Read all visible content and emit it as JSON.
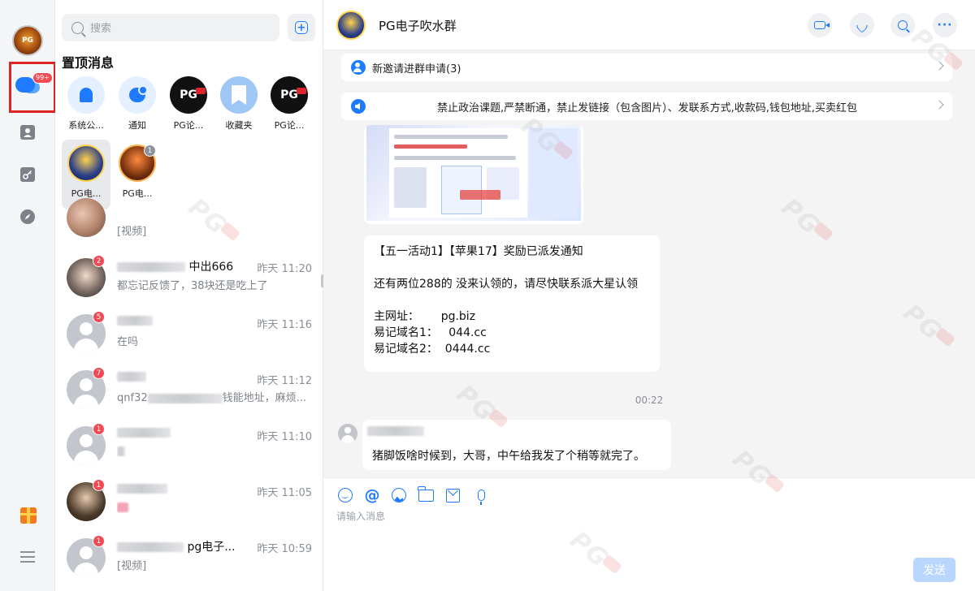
{
  "rail": {
    "avatar_text": "PG",
    "unread_badge": "99+",
    "accent": "#1E7BFF",
    "items": [
      {
        "name": "messages",
        "icon": "chat-bubbles-icon"
      },
      {
        "name": "contacts",
        "icon": "contact-card-icon"
      },
      {
        "name": "tools",
        "icon": "key-icon"
      },
      {
        "name": "discover",
        "icon": "compass-icon"
      }
    ],
    "bottom": [
      {
        "icon": "gift-icon"
      },
      {
        "icon": "menu-icon"
      }
    ]
  },
  "list": {
    "search_placeholder": "搜索",
    "pinned_title": "置顶消息",
    "pinned": [
      {
        "label": "系统公...",
        "kind": "bell"
      },
      {
        "label": "通知",
        "kind": "notice"
      },
      {
        "label": "PG论...",
        "kind": "pg",
        "logo_text": "PG"
      },
      {
        "label": "收藏夹",
        "kind": "fav"
      },
      {
        "label": "PG论...",
        "kind": "pg",
        "logo_text": "PG"
      },
      {
        "label": "PG电...",
        "kind": "pg-char",
        "active": true
      },
      {
        "label": "PG电...",
        "kind": "pg-char2",
        "badge": "1"
      }
    ],
    "conversations": [
      {
        "name": "",
        "time": "",
        "preview": "[视频]",
        "badge": "",
        "avatar": "photo1"
      },
      {
        "name": "中出666",
        "time": "昨天 11:20",
        "preview": "都忘记反馈了，38块还是吃上了",
        "badge": "2",
        "avatar": "photo2"
      },
      {
        "name": "",
        "time": "昨天 11:16",
        "preview": "在吗",
        "badge": "5",
        "avatar": "default"
      },
      {
        "name": "",
        "time": "昨天 11:12",
        "preview_prefix": "qnf32",
        "preview": "钱能地址，麻烦...",
        "badge": "7",
        "avatar": "default"
      },
      {
        "name": "",
        "time": "昨天 11:10",
        "preview": "",
        "badge": "1",
        "avatar": "default"
      },
      {
        "name": "",
        "time": "昨天 11:05",
        "preview": "",
        "badge": "1",
        "avatar": "photo3"
      },
      {
        "name": "pg电子...",
        "time": "昨天 10:59",
        "preview": "[视频]",
        "badge": "1",
        "avatar": "default"
      }
    ]
  },
  "chat": {
    "title": "PG电子吹水群",
    "top_actions": [
      "video-call-icon",
      "phone-icon",
      "search-icon",
      "more-icon"
    ],
    "invite_notice": "新邀请进群申请(3)",
    "announcement": "禁止政治课题,严禁断通，禁止发链接（包含图片）、发联系方式,收款码,钱包地址,买卖红包",
    "message_lines": [
      "【五一活动1】【苹果17】奖励已派发通知",
      "",
      "还有两位288的 没来认领的，请尽快联系派大星认领",
      "",
      "主网址：      pg.biz",
      "易记域名1：   044.cc",
      "易记域名2：  0444.cc"
    ],
    "time_separator": "00:22",
    "reply_text": "猪脚饭啥时候到，大哥，中午给我发了个稍等就完了。",
    "composer": {
      "placeholder": "请输入消息",
      "send_label": "发送",
      "tools": [
        "emoji-icon",
        "at-icon",
        "image-icon",
        "folder-icon",
        "mail-icon",
        "mic-icon"
      ]
    }
  },
  "watermark": "PG"
}
